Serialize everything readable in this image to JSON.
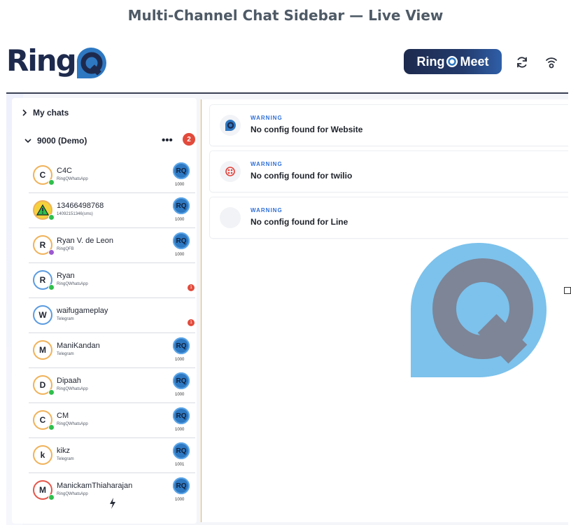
{
  "page_heading": "Multi-Channel Chat Sidebar — Live View",
  "header": {
    "logo_text": "Ring",
    "meet_label_ring": "Ring",
    "meet_label_meet": "Meet",
    "icons": [
      "refresh-icon",
      "signal-icon"
    ]
  },
  "sidebar": {
    "my_chats": "My chats",
    "group": {
      "label": "9000 (Demo)",
      "more": "•••",
      "count": "2"
    },
    "chats": [
      {
        "initial": "C",
        "name": "C4C",
        "channel": "RingQWhatsApp",
        "agent": "RQ",
        "agent_id": "1000",
        "unread": ""
      },
      {
        "initial": "",
        "name": "13466498768",
        "channel": "14092151346(sms)",
        "agent": "RQ",
        "agent_id": "1000",
        "unread": ""
      },
      {
        "initial": "R",
        "name": "Ryan V. de Leon",
        "channel": "RingQFB",
        "agent": "RQ",
        "agent_id": "1000",
        "unread": ""
      },
      {
        "initial": "R",
        "name": "Ryan",
        "channel": "RingQWhatsApp",
        "agent": "",
        "agent_id": "",
        "unread": "1"
      },
      {
        "initial": "W",
        "name": "waifugameplay",
        "channel": "Telegram",
        "agent": "",
        "agent_id": "",
        "unread": "1"
      },
      {
        "initial": "M",
        "name": "ManiKandan",
        "channel": "Telegram",
        "agent": "RQ",
        "agent_id": "1000",
        "unread": ""
      },
      {
        "initial": "D",
        "name": "Dipaah",
        "channel": "RingQWhatsApp",
        "agent": "RQ",
        "agent_id": "1000",
        "unread": ""
      },
      {
        "initial": "C",
        "name": "CM",
        "channel": "RingQWhatsApp",
        "agent": "RQ",
        "agent_id": "1000",
        "unread": ""
      },
      {
        "initial": "k",
        "name": "kikz",
        "channel": "Telegram",
        "agent": "RQ",
        "agent_id": "1001",
        "unread": ""
      },
      {
        "initial": "M",
        "name": "ManickamThiaharajan",
        "channel": "RingQWhatsApp",
        "agent": "RQ",
        "agent_id": "1000",
        "unread": ""
      }
    ]
  },
  "main": {
    "warnings": [
      {
        "level": "WARNING",
        "message": "No config found for Website",
        "icon": "ringq-icon"
      },
      {
        "level": "WARNING",
        "message": "No config found for twilio",
        "icon": "twilio-icon"
      },
      {
        "level": "WARNING",
        "message": "No config found for Line",
        "icon": "line-icon"
      }
    ]
  },
  "colors": {
    "brand_dark": "#1e2a4d",
    "brand_blue": "#2e78c2",
    "logo_light_blue": "#7cc2ec",
    "logo_gray": "#7d8597",
    "warning_blue": "#2f6fd8",
    "badge_red": "#e24a3b",
    "whatsapp_green": "#2fbf4b"
  }
}
